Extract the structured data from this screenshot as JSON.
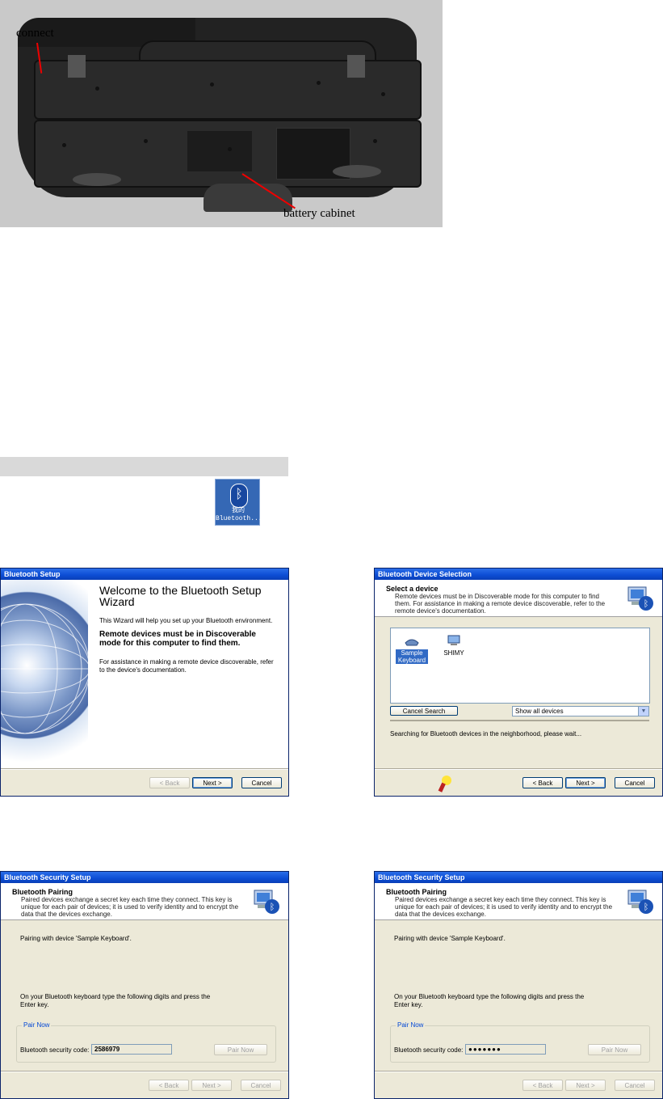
{
  "photo": {
    "connect_label": "connect",
    "battery_label": "battery cabinet"
  },
  "desktop_icon": {
    "line1": "我的",
    "line2": "Bluetooth..."
  },
  "setup_wizard": {
    "title": "Bluetooth Setup",
    "heading": "Welcome to the Bluetooth Setup Wizard",
    "intro": "This Wizard will help you set up your Bluetooth environment.",
    "bold_text": "Remote devices must be in Discoverable mode for this computer to find them.",
    "assist": "For assistance in making a remote device discoverable, refer to the device's documentation.",
    "back": "< Back",
    "next": "Next >",
    "cancel": "Cancel"
  },
  "device_selection": {
    "title": "Bluetooth Device Selection",
    "header_title": "Select a device",
    "header_desc": "Remote devices must be in Discoverable mode for this computer to find them. For assistance in making a remote device discoverable, refer to the remote device's documentation.",
    "devices": [
      {
        "label": "Sample Keyboard",
        "icon": "keyboard-icon",
        "selected": true
      },
      {
        "label": "SHIMY",
        "icon": "computer-icon",
        "selected": false
      }
    ],
    "cancel_search": "Cancel Search",
    "filter": "Show all devices",
    "status": "Searching for Bluetooth devices in the neighborhood, please wait...",
    "back": "< Back",
    "next": "Next >",
    "cancel": "Cancel"
  },
  "security_setup_1": {
    "title": "Bluetooth Security Setup",
    "header_title": "Bluetooth Pairing",
    "header_desc": "Paired devices exchange a secret key each time they connect. This key is unique for each pair of devices; it is used to verify identity and to encrypt the data that the devices exchange.",
    "pairing_with": "Pairing with device 'Sample Keyboard'.",
    "instruction": "On your Bluetooth keyboard type the following digits and press the Enter key.",
    "group_label": "Pair Now",
    "code_label": "Bluetooth security code:",
    "code_value": "2586979",
    "pair_now": "Pair Now",
    "back": "< Back",
    "next": "Next >",
    "cancel": "Cancel"
  },
  "security_setup_2": {
    "title": "Bluetooth Security Setup",
    "header_title": "Bluetooth Pairing",
    "header_desc": "Paired devices exchange a secret key each time they connect. This key is unique for each pair of devices; it is used to verify identity and to encrypt the data that the devices exchange.",
    "pairing_with": "Pairing with device 'Sample Keyboard'.",
    "instruction": "On your Bluetooth keyboard type the following digits and press the Enter key.",
    "group_label": "Pair Now",
    "code_label": "Bluetooth security code:",
    "code_value": "●●●●●●●",
    "pair_now": "Pair Now",
    "back": "< Back",
    "next": "Next >",
    "cancel": "Cancel"
  }
}
